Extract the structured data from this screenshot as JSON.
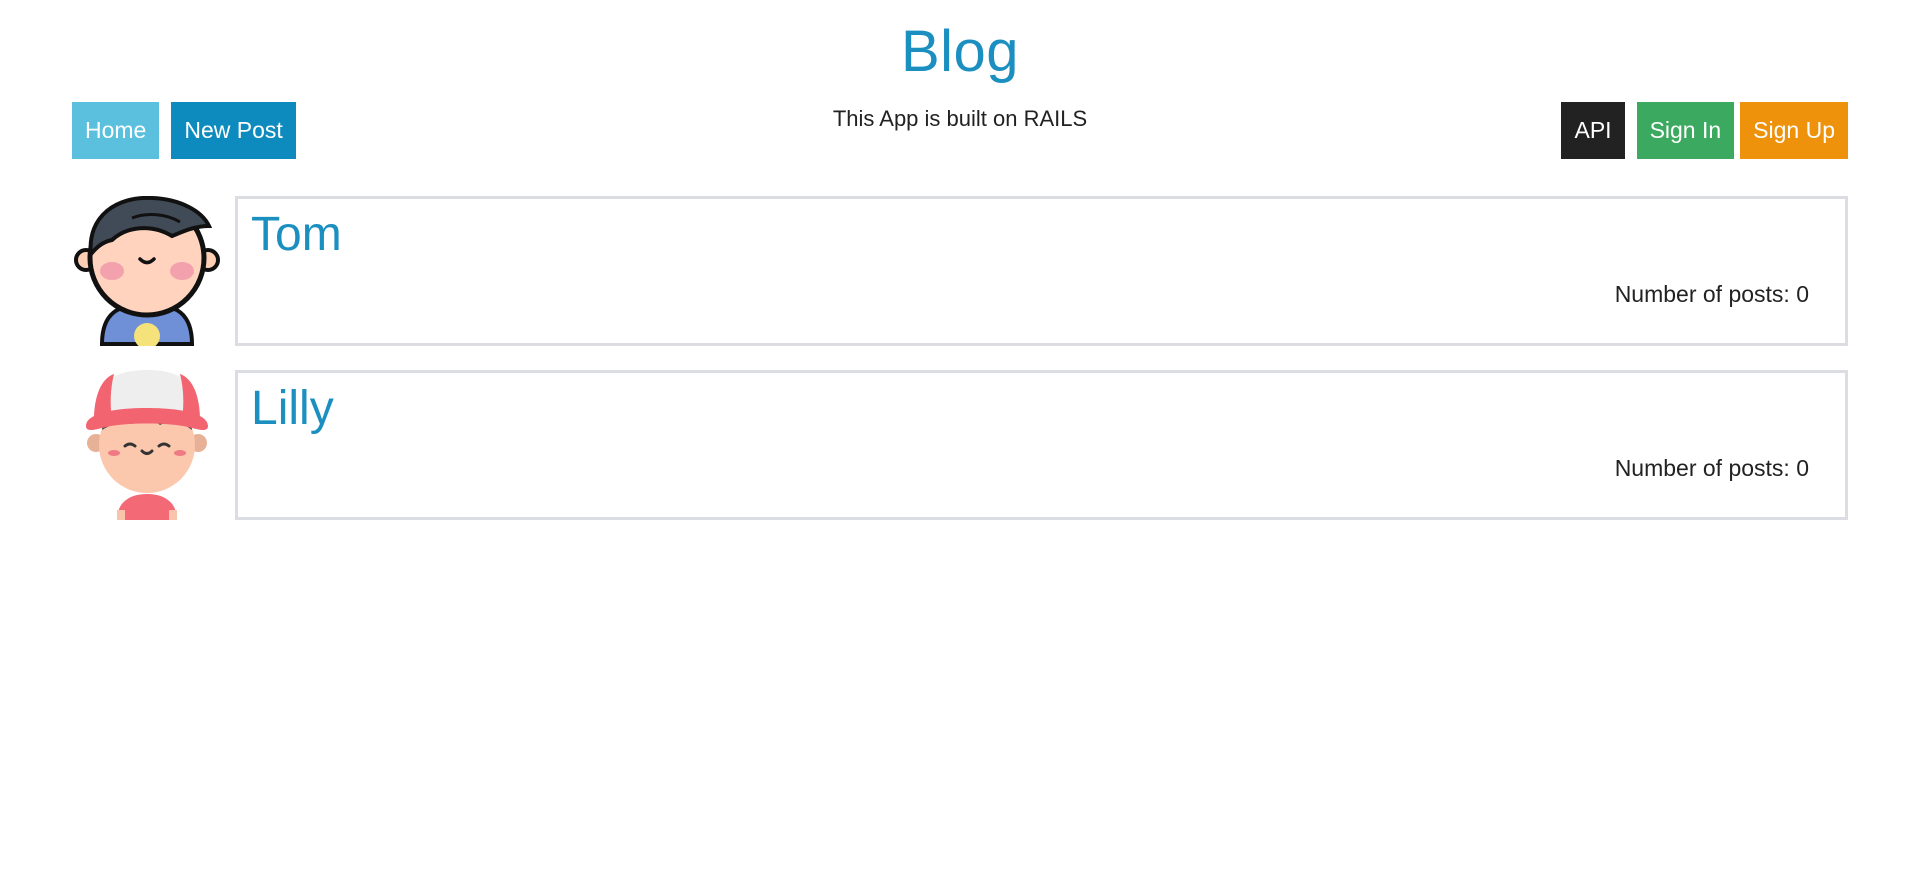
{
  "header": {
    "title": "Blog",
    "tagline": "This App is built on RAILS"
  },
  "nav": {
    "left": [
      {
        "label": "Home",
        "color": "#5bc0de"
      },
      {
        "label": "New Post",
        "color": "#0d8bbe"
      }
    ],
    "right": [
      {
        "label": "API",
        "color": "#222222"
      },
      {
        "label": "Sign In",
        "color": "#3ba95f"
      },
      {
        "label": "Sign Up",
        "color": "#ee920c"
      }
    ]
  },
  "users": [
    {
      "name": "Tom",
      "posts_label": "Number of posts: 0",
      "avatar": "boy-avatar-icon"
    },
    {
      "name": "Lilly",
      "posts_label": "Number of posts: 0",
      "avatar": "girl-cap-avatar-icon"
    }
  ],
  "colors": {
    "accent": "#1b8fc0",
    "card_border": "#dcdde3"
  }
}
